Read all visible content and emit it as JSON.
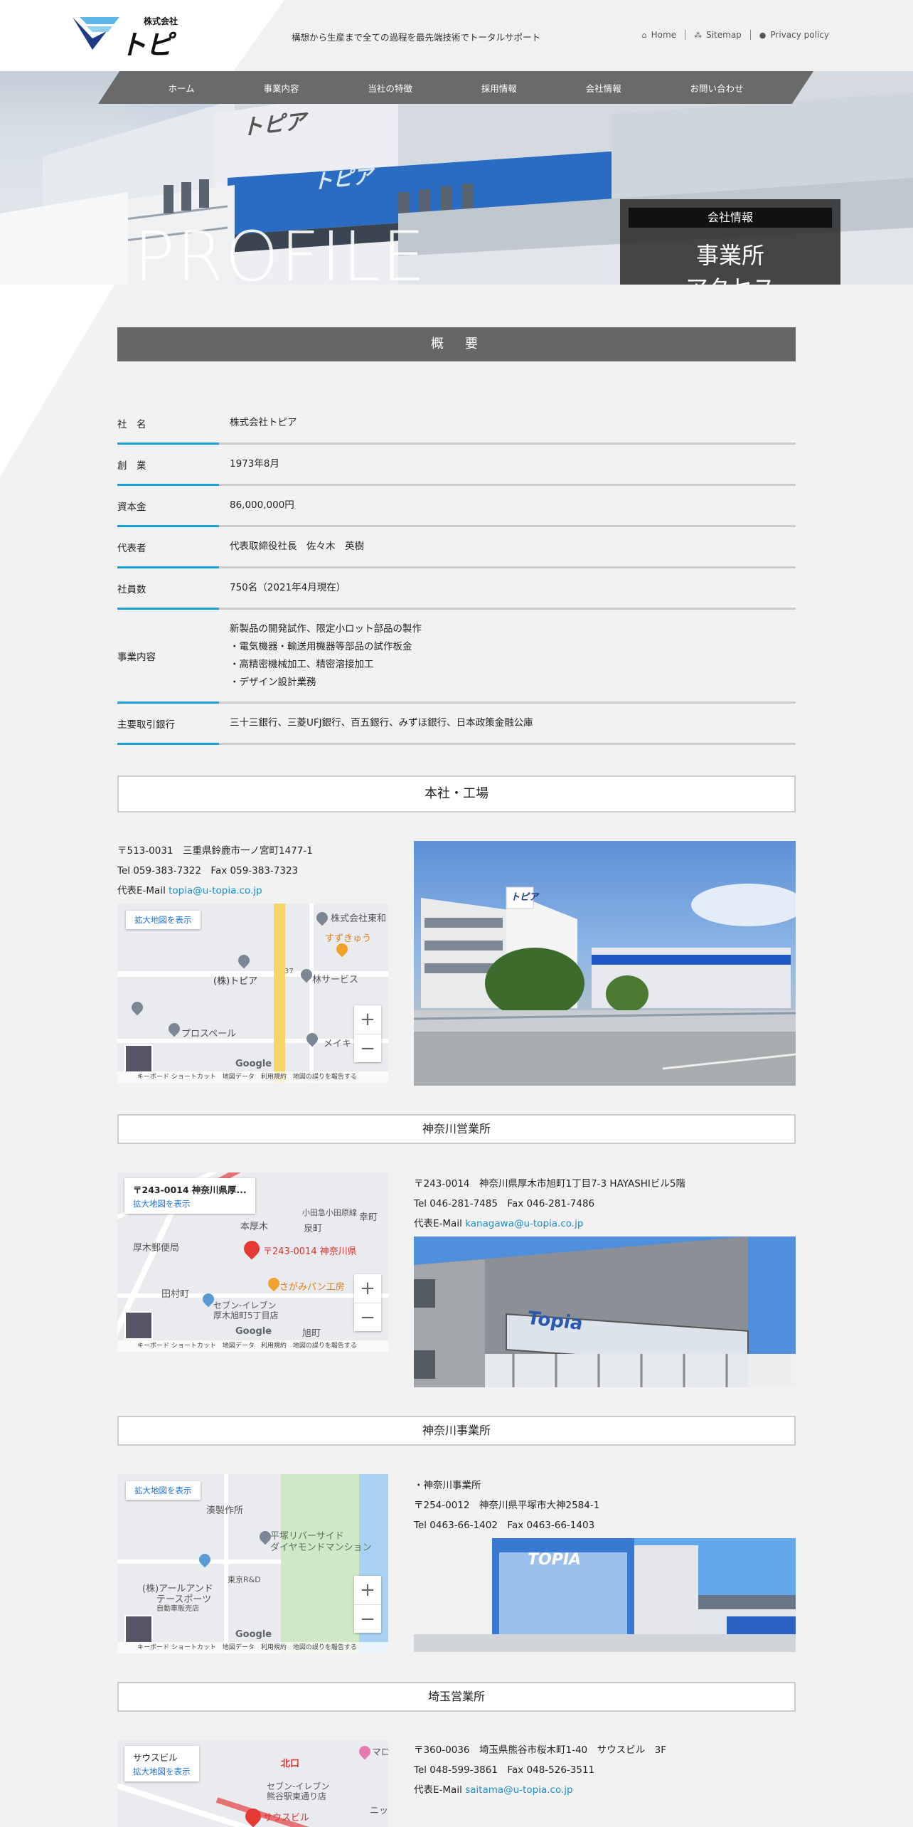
{
  "header": {
    "logo_company": "株式会社",
    "logo_name": "トピア",
    "tagline": "構想から生産まで全ての過程を最先端技術でトータルサポート",
    "links": [
      {
        "icon": "home-icon",
        "label": "Home"
      },
      {
        "icon": "sitemap-icon",
        "label": "Sitemap"
      },
      {
        "icon": "person-icon",
        "label": "Privacy policy"
      }
    ]
  },
  "nav": [
    "ホーム",
    "事業内容",
    "当社の特徴",
    "採用情報",
    "会社情報",
    "お問い合わせ"
  ],
  "hero": {
    "big_text": "PROFILE",
    "box_label": "会社情報",
    "title_line1": "事業所",
    "title_line2": "アクセス",
    "sign_text": "トピア",
    "sign_text_small": "トピア"
  },
  "overview": {
    "heading": "概　要",
    "rows": [
      {
        "key": "社　名",
        "value": "株式会社トピア"
      },
      {
        "key": "創　業",
        "value": "1973年8月"
      },
      {
        "key": "資本金",
        "value": "86,000,000円"
      },
      {
        "key": "代表者",
        "value": "代表取締役社長　佐々木　英樹"
      },
      {
        "key": "社員数",
        "value": "750名（2021年4月現在）"
      },
      {
        "key": "事業内容",
        "lines": [
          "新製品の開発試作、限定小ロット部品の製作",
          "・電気機器・輸送用機器等部品の試作板金",
          "・高精密機械加工、精密溶接加工",
          "・デザイン設計業務"
        ]
      },
      {
        "key": "主要取引銀行",
        "value": "三十三銀行、三菱UFJ銀行、百五銀行、みずほ銀行、日本政策金融公庫"
      }
    ]
  },
  "offices": [
    {
      "title": "本社・工場",
      "postal_address": "〒513-0031　三重県鈴鹿市一ノ宮町1477-1",
      "tel_fax": "Tel 059-383-7322　Fax 059-383-7323",
      "email_label": "代表E-Mail ",
      "email": "topia@u-topia.co.jp",
      "map": {
        "enlarge": "拡大地図を表示",
        "labels": [
          "株式会社東和",
          "すずきゅう",
          "(株)トピア",
          "林サービス",
          "プロスペール",
          "メイキ"
        ],
        "road_number": "37"
      }
    },
    {
      "title": "神奈川営業所",
      "postal_address": "〒243-0014　神奈川県厚木市旭町1丁目7-3 HAYASHIビル5階",
      "tel_fax": "Tel 046-281-7485　Fax 046-281-7486",
      "email_label": "代表E-Mail ",
      "email": "kanagawa@u-topia.co.jp",
      "map": {
        "card_title": "〒243-0014 神奈川県厚...",
        "enlarge": "拡大地図を表示",
        "labels": [
          "本厚木",
          "厚木郵便局",
          "小田急小田原線",
          "泉町",
          "幸町",
          "〒243-0014 神奈川県",
          "田村町",
          "セブン-イレブン",
          "厚木旭町5丁目店",
          "さがみパン工房",
          "旭町"
        ]
      }
    },
    {
      "title": "神奈川事業所",
      "name_line": "・神奈川事業所",
      "postal_address": "〒254-0012　神奈川県平塚市大神2584-1",
      "tel_fax": "Tel 0463-66-1402　Fax 0463-66-1403",
      "map": {
        "enlarge": "拡大地図を表示",
        "labels": [
          "湊製作所",
          "平塚リバーサイド",
          "ダイヤモンドマンション",
          "東京R&D",
          "(株)アールアンド",
          "テースポーツ",
          "自動車販売店"
        ]
      },
      "photo_sign": "TOPIA"
    },
    {
      "title": "埼玉営業所",
      "postal_address": "〒360-0036　埼玉県熊谷市桜木町1-40　サウスビル　3F",
      "tel_fax": "Tel 048-599-3861　Fax 048-526-3511",
      "email_label": "代表E-Mail ",
      "email": "saitama@u-topia.co.jp",
      "map": {
        "card_title": "サウスビル",
        "enlarge": "拡大地図を表示",
        "labels": [
          "北口",
          "マロ",
          "セブン-イレブン",
          "熊谷駅東通り店",
          "サウスビル",
          "ニッ"
        ]
      }
    }
  ],
  "map_common": {
    "google": "Google",
    "footer": "キーボード ショートカット　地図データ　利用規約　地図の誤りを報告する",
    "zoom_in": "+",
    "zoom_out": "−"
  },
  "photo_signs": {
    "hq": "トピア",
    "kanagawa": "Topia"
  },
  "colors": {
    "accent": "#1b9ed9",
    "nav": "#6a6a6a",
    "heading_bar": "#666666",
    "link": "#1b8fd0"
  }
}
